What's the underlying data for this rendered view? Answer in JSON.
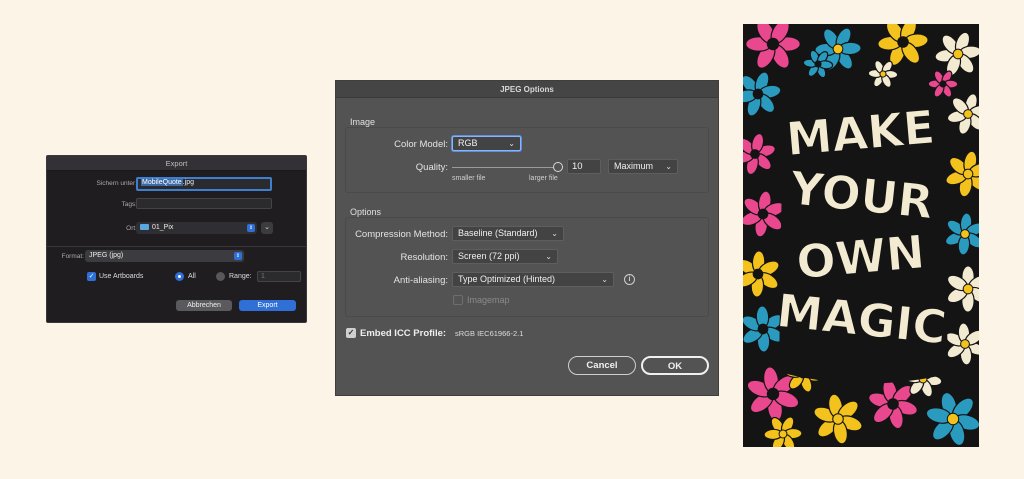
{
  "export_dialog": {
    "title": "Export",
    "save_as_label": "Sichern unter:",
    "filename_selected": "MobileQuote",
    "filename_ext": ".jpg",
    "tags_label": "Tags:",
    "tags_value": "",
    "location_label": "Ort:",
    "location_value": "01_Pix",
    "format_label": "Format:",
    "format_value": "JPEG (jpg)",
    "use_artboards_label": "Use Artboards",
    "use_artboards_checked": true,
    "all_label": "All",
    "range_label": "Range:",
    "range_value": "1",
    "cancel_label": "Abbrechen",
    "export_label": "Export"
  },
  "jpeg_options": {
    "title": "JPEG Options",
    "image_group": "Image",
    "color_model_label": "Color Model:",
    "color_model_value": "RGB",
    "quality_label": "Quality:",
    "quality_value": "10",
    "quality_fraction": 1.0,
    "quality_preset": "Maximum",
    "smaller_file": "smaller file",
    "larger_file": "larger file",
    "options_group": "Options",
    "compression_label": "Compression Method:",
    "compression_value": "Baseline (Standard)",
    "resolution_label": "Resolution:",
    "resolution_value": "Screen (72 ppi)",
    "antialiasing_label": "Anti-aliasing:",
    "antialiasing_value": "Type Optimized (Hinted)",
    "imagemap_label": "Imagemap",
    "imagemap_checked": false,
    "embed_icc_label": "Embed ICC Profile:",
    "embed_icc_value": "sRGB IEC61966-2.1",
    "embed_icc_checked": true,
    "cancel_label": "Cancel",
    "ok_label": "OK"
  },
  "poster": {
    "lettering": "MAKE YOUR OWN MAGIC",
    "colors": {
      "pink": "#e9478e",
      "teal": "#2a9bbf",
      "yellow": "#f4c21c",
      "cream": "#f3ead2",
      "dark": "#141414"
    }
  }
}
